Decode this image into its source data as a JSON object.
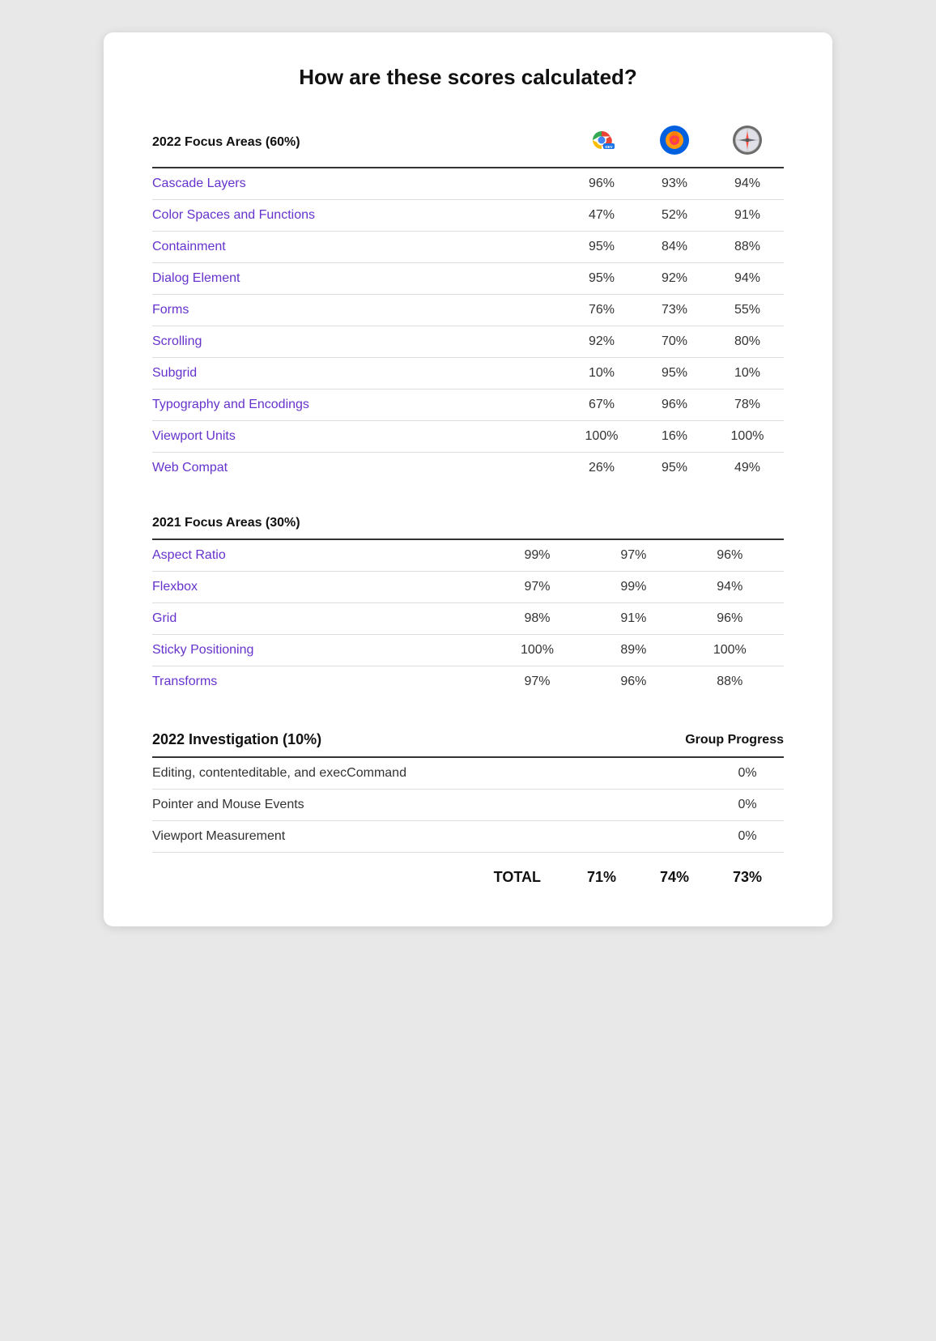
{
  "page": {
    "title": "How are these scores calculated?"
  },
  "sections": [
    {
      "id": "focus2022",
      "label": "2022 Focus Areas (60%)",
      "type": "scored",
      "rows": [
        {
          "label": "Cascade Layers",
          "scores": [
            "96%",
            "93%",
            "94%"
          ]
        },
        {
          "label": "Color Spaces and Functions",
          "scores": [
            "47%",
            "52%",
            "91%"
          ]
        },
        {
          "label": "Containment",
          "scores": [
            "95%",
            "84%",
            "88%"
          ]
        },
        {
          "label": "Dialog Element",
          "scores": [
            "95%",
            "92%",
            "94%"
          ]
        },
        {
          "label": "Forms",
          "scores": [
            "76%",
            "73%",
            "55%"
          ]
        },
        {
          "label": "Scrolling",
          "scores": [
            "92%",
            "70%",
            "80%"
          ]
        },
        {
          "label": "Subgrid",
          "scores": [
            "10%",
            "95%",
            "10%"
          ]
        },
        {
          "label": "Typography and Encodings",
          "scores": [
            "67%",
            "96%",
            "78%"
          ]
        },
        {
          "label": "Viewport Units",
          "scores": [
            "100%",
            "16%",
            "100%"
          ]
        },
        {
          "label": "Web Compat",
          "scores": [
            "26%",
            "95%",
            "49%"
          ]
        }
      ]
    },
    {
      "id": "focus2021",
      "label": "2021 Focus Areas (30%)",
      "type": "scored",
      "rows": [
        {
          "label": "Aspect Ratio",
          "scores": [
            "99%",
            "97%",
            "96%"
          ]
        },
        {
          "label": "Flexbox",
          "scores": [
            "97%",
            "99%",
            "94%"
          ]
        },
        {
          "label": "Grid",
          "scores": [
            "98%",
            "91%",
            "96%"
          ]
        },
        {
          "label": "Sticky Positioning",
          "scores": [
            "100%",
            "89%",
            "100%"
          ]
        },
        {
          "label": "Transforms",
          "scores": [
            "97%",
            "96%",
            "88%"
          ]
        }
      ]
    },
    {
      "id": "investigation2022",
      "label": "2022 Investigation (10%)",
      "type": "investigation",
      "group_progress_label": "Group Progress",
      "rows": [
        {
          "label": "Editing, contenteditable, and execCommand",
          "score": "0%"
        },
        {
          "label": "Pointer and Mouse Events",
          "score": "0%"
        },
        {
          "label": "Viewport Measurement",
          "score": "0%"
        }
      ]
    }
  ],
  "total": {
    "label": "TOTAL",
    "scores": [
      "71%",
      "74%",
      "73%"
    ]
  },
  "browsers": [
    {
      "name": "Chrome Dev",
      "icon_type": "chrome"
    },
    {
      "name": "Firefox",
      "icon_type": "firefox"
    },
    {
      "name": "Safari",
      "icon_type": "safari"
    }
  ]
}
